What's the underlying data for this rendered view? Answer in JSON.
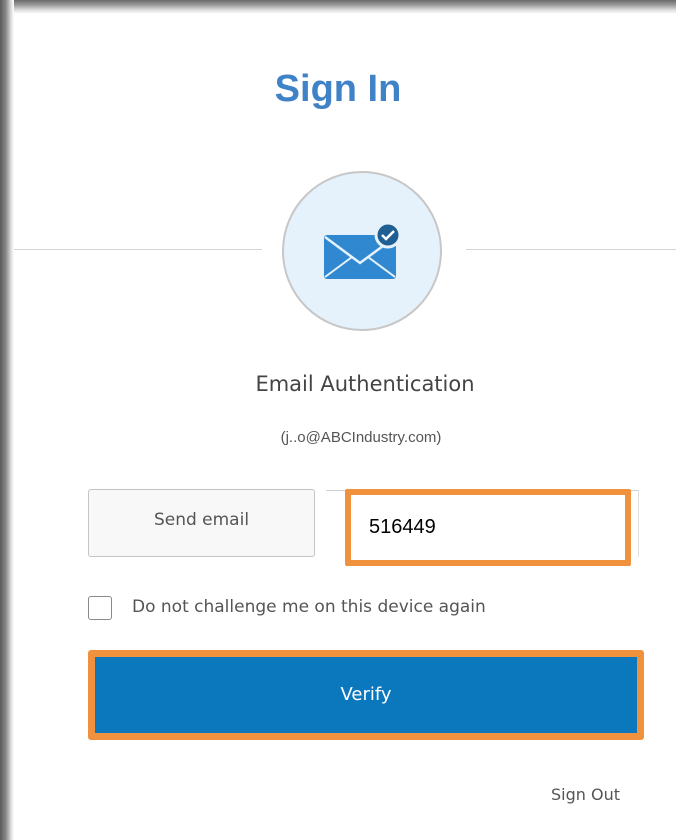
{
  "page": {
    "title": "Sign In"
  },
  "auth": {
    "heading": "Email Authentication",
    "email": "(j..o@ABCIndustry.com)"
  },
  "form": {
    "send_label": "Send email",
    "code_value": "516449",
    "remember_label": "Do not challenge me on this device again",
    "remember_checked": false,
    "verify_label": "Verify"
  },
  "footer": {
    "sign_out_label": "Sign Out"
  },
  "icons": {
    "email_status": "envelope-check-icon"
  },
  "colors": {
    "title": "#3f82c7",
    "primary_button": "#0b77bd",
    "highlight": "#f0913e",
    "icon_bg": "#e6f2fb"
  }
}
